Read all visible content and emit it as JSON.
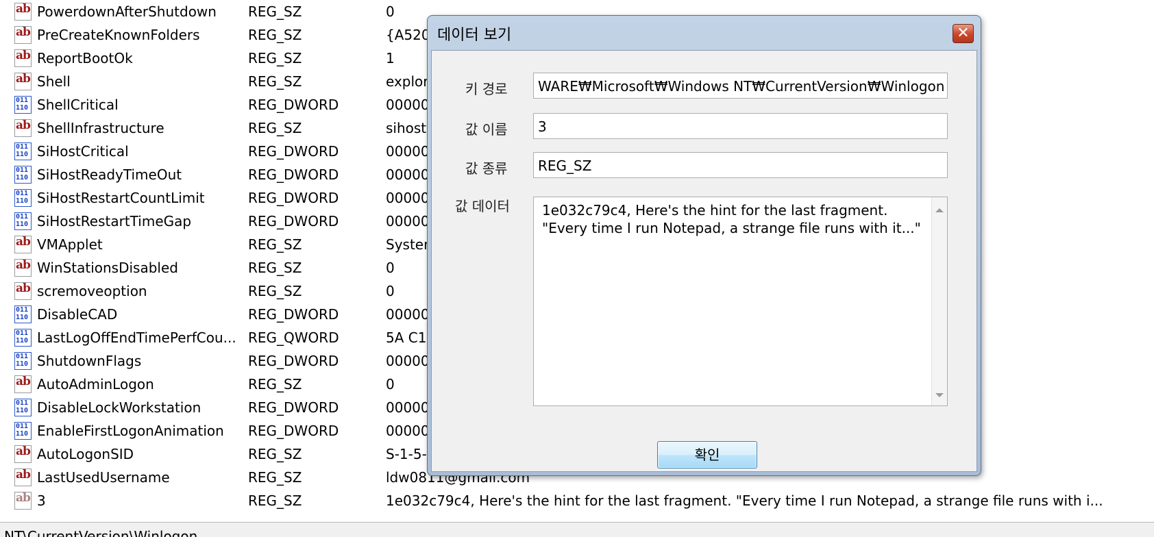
{
  "registry": {
    "rows": [
      {
        "icon": "string-icon",
        "name": "PowerdownAfterShutdown",
        "type": "REG_SZ",
        "data": "0"
      },
      {
        "icon": "string-icon",
        "name": "PreCreateKnownFolders",
        "type": "REG_SZ",
        "data": "{A520"
      },
      {
        "icon": "string-icon",
        "name": "ReportBootOk",
        "type": "REG_SZ",
        "data": "1"
      },
      {
        "icon": "string-icon",
        "name": "Shell",
        "type": "REG_SZ",
        "data": "explor"
      },
      {
        "icon": "binary-icon",
        "name": "ShellCritical",
        "type": "REG_DWORD",
        "data": "00000"
      },
      {
        "icon": "string-icon",
        "name": "ShellInfrastructure",
        "type": "REG_SZ",
        "data": "sihost"
      },
      {
        "icon": "binary-icon",
        "name": "SiHostCritical",
        "type": "REG_DWORD",
        "data": "00000"
      },
      {
        "icon": "binary-icon",
        "name": "SiHostReadyTimeOut",
        "type": "REG_DWORD",
        "data": "00000"
      },
      {
        "icon": "binary-icon",
        "name": "SiHostRestartCountLimit",
        "type": "REG_DWORD",
        "data": "00000"
      },
      {
        "icon": "binary-icon",
        "name": "SiHostRestartTimeGap",
        "type": "REG_DWORD",
        "data": "00000"
      },
      {
        "icon": "string-icon",
        "name": "VMApplet",
        "type": "REG_SZ",
        "data": "Syster"
      },
      {
        "icon": "string-icon",
        "name": "WinStationsDisabled",
        "type": "REG_SZ",
        "data": "0"
      },
      {
        "icon": "string-icon",
        "name": "scremoveoption",
        "type": "REG_SZ",
        "data": "0"
      },
      {
        "icon": "binary-icon",
        "name": "DisableCAD",
        "type": "REG_DWORD",
        "data": "00000"
      },
      {
        "icon": "binary-icon",
        "name": "LastLogOffEndTimePerfCou...",
        "type": "REG_QWORD",
        "data": "5A C1"
      },
      {
        "icon": "binary-icon",
        "name": "ShutdownFlags",
        "type": "REG_DWORD",
        "data": "00000"
      },
      {
        "icon": "string-icon",
        "name": "AutoAdminLogon",
        "type": "REG_SZ",
        "data": "0"
      },
      {
        "icon": "binary-icon",
        "name": "DisableLockWorkstation",
        "type": "REG_DWORD",
        "data": "00000"
      },
      {
        "icon": "binary-icon",
        "name": "EnableFirstLogonAnimation",
        "type": "REG_DWORD",
        "data": "00000"
      },
      {
        "icon": "string-icon",
        "name": "AutoLogonSID",
        "type": "REG_SZ",
        "data": "S-1-5-"
      },
      {
        "icon": "string-icon",
        "name": "LastUsedUsername",
        "type": "REG_SZ",
        "data": "ldw0811@gmail.com"
      },
      {
        "icon": "string-icon",
        "name": "3",
        "type": "REG_SZ",
        "data": "1e032c79c4, Here's the hint for the last fragment. \"Every time I run Notepad, a strange file runs with i..."
      }
    ]
  },
  "statusbar": {
    "text": "NT\\CurrentVersion\\Winlogon"
  },
  "dialog": {
    "title": "데이터 보기",
    "close_glyph": "✕",
    "key_path_label": "키 경로",
    "key_path_value": "WARE₩Microsoft₩Windows NT₩CurrentVersion₩Winlogon",
    "value_name_label": "값 이름",
    "value_name_value": "3",
    "value_type_label": "값 종류",
    "value_type_value": "REG_SZ",
    "value_data_label": "값 데이터",
    "value_data_value": "1e032c79c4, Here's the hint for the last fragment.\n\"Every time I run Notepad, a strange file runs with it...\"",
    "ok_label": "확인"
  }
}
